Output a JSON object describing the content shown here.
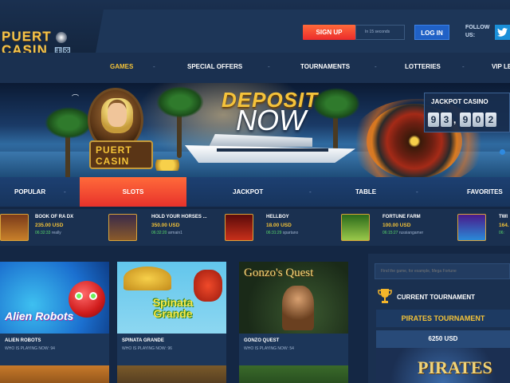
{
  "logo": {
    "line1": "PUERT",
    "line2": "CASIN",
    "dice": "⚅⚄"
  },
  "header": {
    "signup_label": "SIGN UP",
    "signup_note": "In 15 seconds",
    "login_label": "LOG IN",
    "follow_label": "FOLLOW US:",
    "twitter_icon": "twitter-icon"
  },
  "nav": {
    "items": [
      {
        "label": "GAMES"
      },
      {
        "label": "SPECIAL OFFERS"
      },
      {
        "label": "TOURNAMENTS"
      },
      {
        "label": "LOTTERIES"
      },
      {
        "label": "VIP LE"
      }
    ],
    "separator": "-"
  },
  "banner": {
    "deposit": "DEPOSIT",
    "now": "NOW",
    "logo_line1": "PUERT",
    "logo_line2": "CASIN"
  },
  "jackpot": {
    "title": "JACKPOT CASINO",
    "digits": [
      "9",
      "3",
      "9",
      "0",
      "2"
    ],
    "separator": ","
  },
  "categories": {
    "items": [
      {
        "label": "POPULAR"
      },
      {
        "label": "SLOTS"
      },
      {
        "label": "JACKPOT"
      },
      {
        "label": "TABLE"
      },
      {
        "label": "FAVORITES"
      }
    ],
    "separator": "-"
  },
  "winners": [
    {
      "game": "BOOK OF RA DX",
      "amount": "235.00 USD",
      "time": "06:32:33",
      "user": "really"
    },
    {
      "game": "HOLD YOUR HORSES ...",
      "amount": "350.00 USD",
      "time": "06:32:20",
      "user": "armain1"
    },
    {
      "game": "HELLBOY",
      "amount": "18.00 USD",
      "time": "06:31:29",
      "user": "spartano"
    },
    {
      "game": "FORTUNE FARM",
      "amount": "100.00 USD",
      "time": "06:15:27",
      "user": "russiangamer"
    },
    {
      "game": "TWI",
      "amount": "164.",
      "time": "06:",
      "user": ""
    }
  ],
  "games": [
    {
      "title": "ALIEN ROBOTS",
      "playing": "WHO IS PLAYING NOW: 94",
      "art_text": "Alien Robots"
    },
    {
      "title": "SPINATA GRANDE",
      "playing": "WHO IS PLAYING NOW: 96",
      "art_text": "Spinata Grande"
    },
    {
      "title": "GONZO QUEST",
      "playing": "WHO IS PLAYING NOW: 54",
      "art_text": "Gonzo's Quest"
    }
  ],
  "sidebar": {
    "search_placeholder": "Find the game, for example, Mega Fortune",
    "current_tournament": "CURRENT TOURNAMENT",
    "tournament_name": "PIRATES TOURNAMENT",
    "tournament_prize": "6250 USD",
    "tournament_art_text": "PIRATES"
  },
  "colors": {
    "background": "#142744",
    "accent_orange": "#ff6a3a",
    "accent_gold": "#f4c338",
    "login_blue": "#2061c6"
  }
}
